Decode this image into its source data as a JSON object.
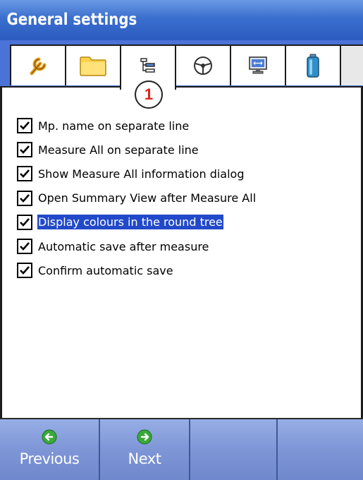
{
  "window": {
    "title": "General settings"
  },
  "tabs": [
    {
      "icon": "wrench-icon"
    },
    {
      "icon": "folder-icon"
    },
    {
      "icon": "tree-view-icon",
      "active": true
    },
    {
      "icon": "steering-wheel-icon"
    },
    {
      "icon": "monitor-icon"
    },
    {
      "icon": "battery-icon"
    }
  ],
  "callout": {
    "number": "1"
  },
  "options": [
    {
      "label": "Mp. name on separate line",
      "checked": true
    },
    {
      "label": "Measure All on separate line",
      "checked": true
    },
    {
      "label": "Show Measure All information dialog",
      "checked": true
    },
    {
      "label": "Open Summary View after Measure All",
      "checked": true
    },
    {
      "label": "Display colours in the round tree",
      "checked": true,
      "selected": true
    },
    {
      "label": "Automatic save after measure",
      "checked": true
    },
    {
      "label": "Confirm automatic save",
      "checked": true
    }
  ],
  "bottom_bar": {
    "previous_label": "Previous",
    "next_label": "Next",
    "previous_icon": "arrow-left-icon",
    "next_icon": "arrow-right-icon"
  },
  "colors": {
    "title_bar": "#3b6fce",
    "tab_strip": "#4b72d6",
    "selection": "#2149c9",
    "bottom_bar": "#7e96d6",
    "nav_icon_green": "#3aa83a",
    "callout_number": "#e2231a"
  }
}
